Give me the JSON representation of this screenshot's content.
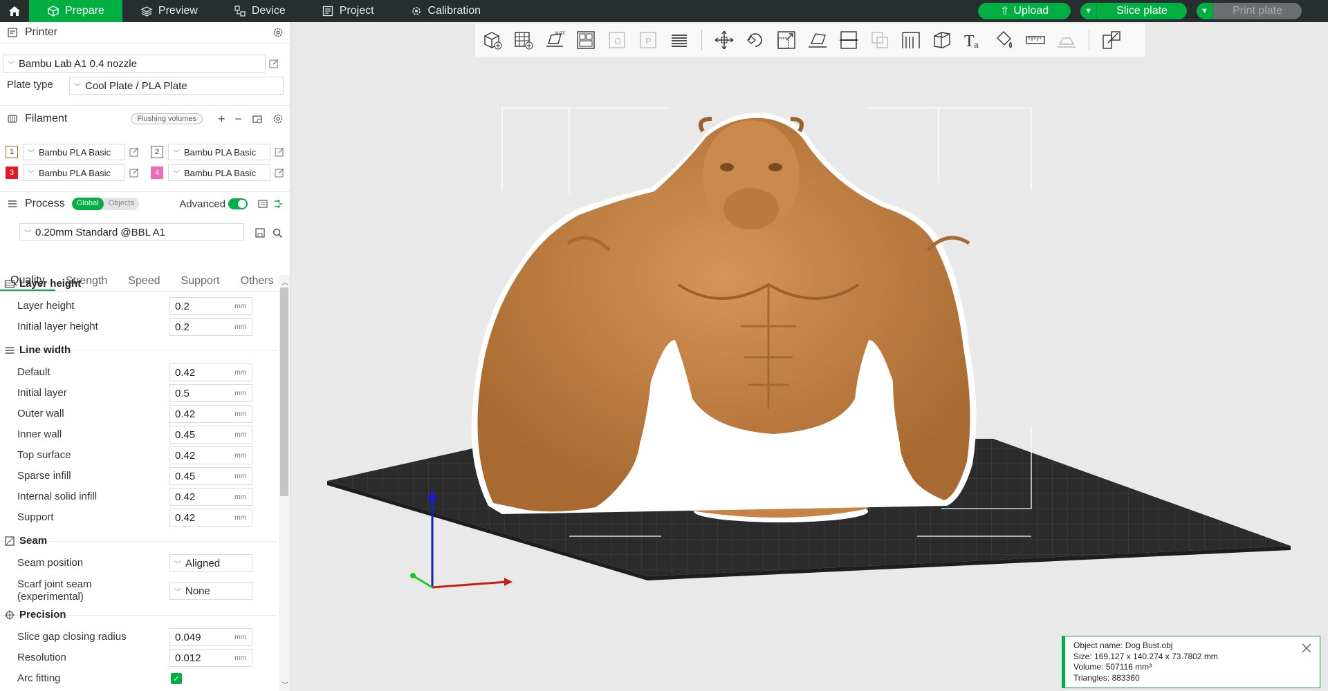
{
  "topbar": {
    "tabs": [
      {
        "label": "Prepare",
        "icon": "cube-icon"
      },
      {
        "label": "Preview",
        "icon": "layers-icon"
      },
      {
        "label": "Device",
        "icon": "device-icon"
      },
      {
        "label": "Project",
        "icon": "project-icon"
      },
      {
        "label": "Calibration",
        "icon": "calibration-icon"
      }
    ],
    "upload_label": "Upload",
    "slice_label": "Slice plate",
    "print_label": "Print plate"
  },
  "printer": {
    "section_title": "Printer",
    "preset": "Bambu Lab A1 0.4 nozzle",
    "plate_type_label": "Plate type",
    "plate_type": "Cool Plate / PLA Plate"
  },
  "filament": {
    "section_title": "Filament",
    "flushing_label": "Flushing volumes",
    "slots": [
      {
        "num": "1",
        "name": "Bambu PLA Basic",
        "color": "#c8874a"
      },
      {
        "num": "2",
        "name": "Bambu PLA Basic",
        "color": "#ffffff"
      },
      {
        "num": "3",
        "name": "Bambu PLA Basic",
        "color": "#e51b24"
      },
      {
        "num": "4",
        "name": "Bambu PLA Basic",
        "color": "#f06ab6"
      }
    ]
  },
  "process": {
    "section_title": "Process",
    "global_label": "Global",
    "objects_label": "Objects",
    "advanced_label": "Advanced",
    "preset": "0.20mm Standard @BBL A1",
    "tabs": [
      "Quality",
      "Strength",
      "Speed",
      "Support",
      "Others"
    ],
    "groups": {
      "layer_height": {
        "title": "Layer height",
        "rows": [
          {
            "label": "Layer height",
            "value": "0.2",
            "unit": "mm"
          },
          {
            "label": "Initial layer height",
            "value": "0.2",
            "unit": "mm"
          }
        ]
      },
      "line_width": {
        "title": "Line width",
        "rows": [
          {
            "label": "Default",
            "value": "0.42",
            "unit": "mm"
          },
          {
            "label": "Initial layer",
            "value": "0.5",
            "unit": "mm"
          },
          {
            "label": "Outer wall",
            "value": "0.42",
            "unit": "mm"
          },
          {
            "label": "Inner wall",
            "value": "0.45",
            "unit": "mm"
          },
          {
            "label": "Top surface",
            "value": "0.42",
            "unit": "mm"
          },
          {
            "label": "Sparse infill",
            "value": "0.45",
            "unit": "mm"
          },
          {
            "label": "Internal solid infill",
            "value": "0.42",
            "unit": "mm"
          },
          {
            "label": "Support",
            "value": "0.42",
            "unit": "mm"
          }
        ]
      },
      "seam": {
        "title": "Seam",
        "seam_position_label": "Seam position",
        "seam_position": "Aligned",
        "scarf_label_1": "Scarf joint seam",
        "scarf_label_2": "(experimental)",
        "scarf_value": "None"
      },
      "precision": {
        "title": "Precision",
        "rows": [
          {
            "label": "Slice gap closing radius",
            "value": "0.049",
            "unit": "mm"
          },
          {
            "label": "Resolution",
            "value": "0.012",
            "unit": "mm"
          }
        ],
        "arc_fitting_label": "Arc fitting",
        "arc_fitting": true
      }
    }
  },
  "object_info": {
    "name": "Object name: Dog Bust.obj",
    "size": "Size: 169.127 x 140.274 x 73.7802 mm",
    "volume": "Volume: 507116 mm³",
    "triangles": "Triangles: 883360"
  },
  "colors": {
    "accent": "#00ae42",
    "topbar": "#262e30",
    "model": "#c8874a",
    "bed": "#2b2b2b"
  }
}
